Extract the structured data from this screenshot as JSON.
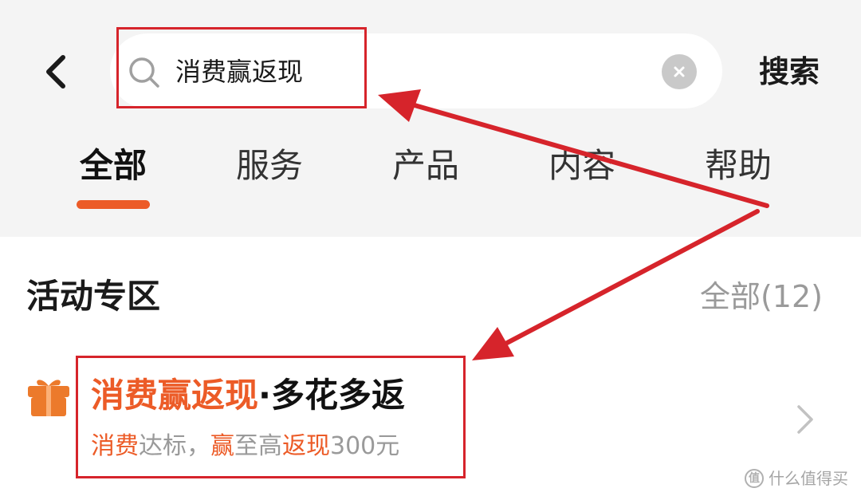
{
  "search": {
    "query": "消费赢返现",
    "submit_label": "搜索"
  },
  "tabs": [
    {
      "label": "全部",
      "active": true
    },
    {
      "label": "服务",
      "active": false
    },
    {
      "label": "产品",
      "active": false
    },
    {
      "label": "内容",
      "active": false
    },
    {
      "label": "帮助",
      "active": false
    }
  ],
  "section": {
    "title": "活动专区",
    "more_label": "全部(12)"
  },
  "promo": {
    "title_highlight": "消费赢返现",
    "title_rest": "·多花多返",
    "subtitle": {
      "part1_hl": "消费",
      "part2": "达标，",
      "part3_hl": "赢",
      "part4": "至高",
      "part5_hl": "返现",
      "part6": "300元"
    }
  },
  "watermark": {
    "logo": "值",
    "text": "什么值得买"
  },
  "colors": {
    "accent": "#ec5b27",
    "annotation": "#d6242b",
    "header_bg": "#f4f4f4"
  },
  "icons": {
    "back": "chevron-left-icon",
    "search": "search-icon",
    "clear": "clear-icon",
    "gift": "gift-icon",
    "more": "chevron-right-icon"
  }
}
